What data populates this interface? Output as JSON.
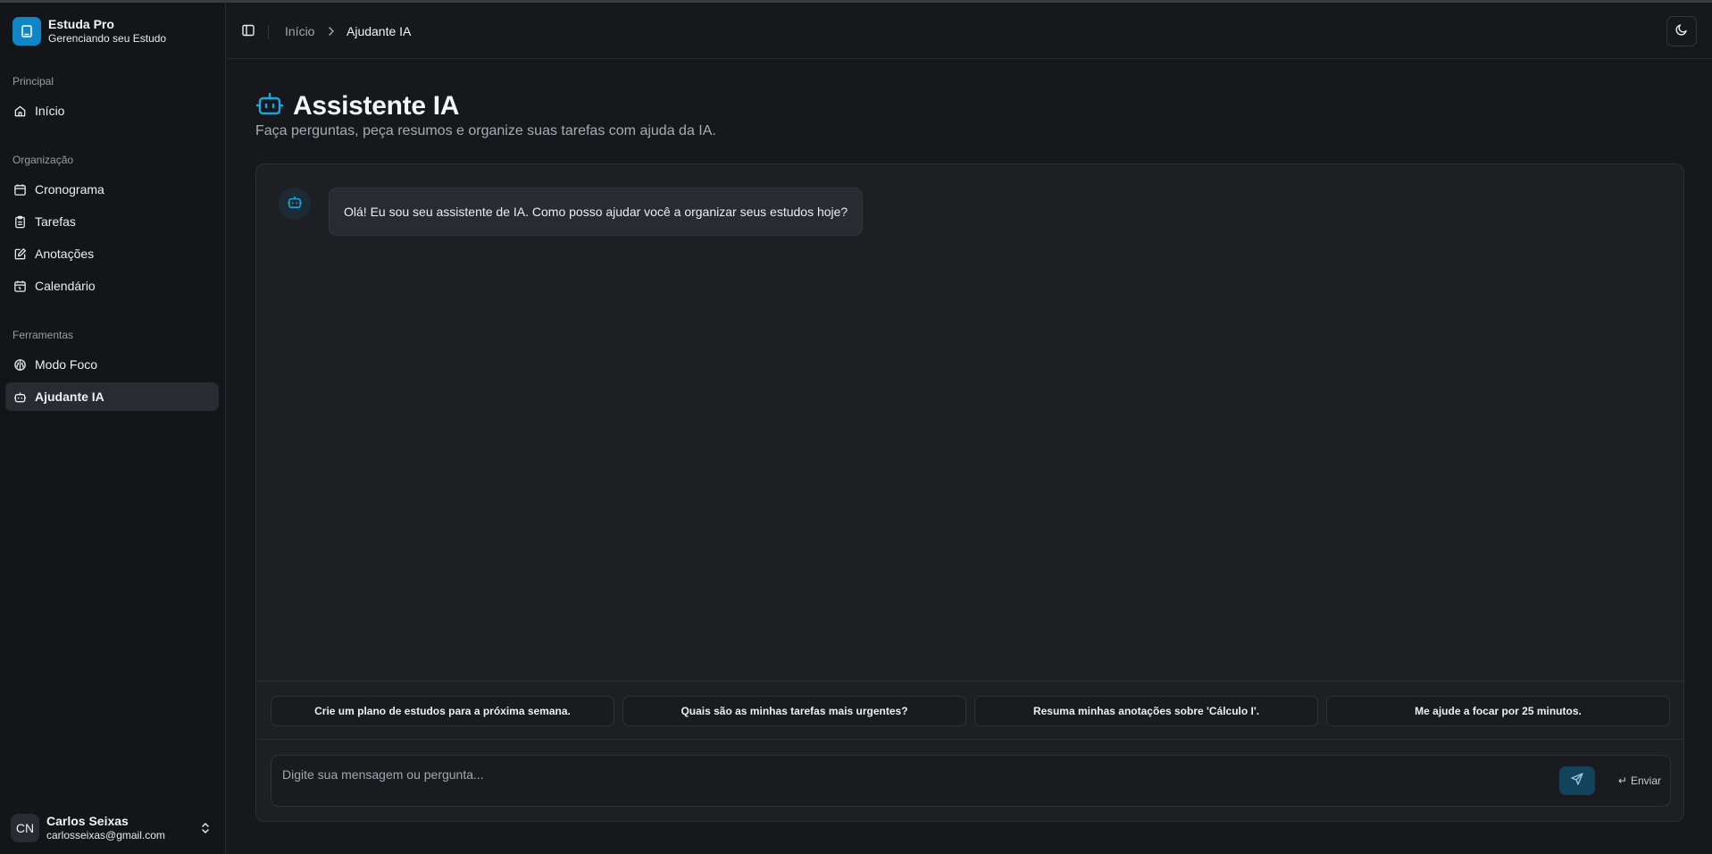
{
  "app": {
    "name": "Estuda Pro",
    "tagline": "Gerenciando seu Estudo"
  },
  "sidebar": {
    "groups": [
      {
        "label": "Principal",
        "items": [
          {
            "label": "Início",
            "icon": "home-icon"
          }
        ]
      },
      {
        "label": "Organização",
        "items": [
          {
            "label": "Cronograma",
            "icon": "calendar-icon"
          },
          {
            "label": "Tarefas",
            "icon": "clipboard-icon"
          },
          {
            "label": "Anotações",
            "icon": "edit-note-icon"
          },
          {
            "label": "Calendário",
            "icon": "calendar-days-icon"
          }
        ]
      },
      {
        "label": "Ferramentas",
        "items": [
          {
            "label": "Modo Foco",
            "icon": "brain-icon"
          },
          {
            "label": "Ajudante IA",
            "icon": "bot-icon",
            "active": true
          }
        ]
      }
    ]
  },
  "user": {
    "initials": "CN",
    "name": "Carlos Seixas",
    "email": "carlosseixas@gmail.com"
  },
  "header": {
    "breadcrumb_home": "Início",
    "breadcrumb_current": "Ajudante IA"
  },
  "page": {
    "title": "Assistente IA",
    "subtitle": "Faça perguntas, peça resumos e organize suas tarefas com ajuda da IA."
  },
  "chat": {
    "messages": [
      {
        "role": "assistant",
        "text": "Olá! Eu sou seu assistente de IA. Como posso ajudar você a organizar seus estudos hoje?"
      }
    ],
    "suggestions": [
      "Crie um plano de estudos para a próxima semana.",
      "Quais são as minhas tarefas mais urgentes?",
      "Resuma minhas anotações sobre 'Cálculo I'.",
      "Me ajude a focar por 25 minutos."
    ],
    "input_placeholder": "Digite sua mensagem ou pergunta...",
    "send_hint_key": "↵",
    "send_hint_label": "Enviar"
  },
  "colors": {
    "accent": "#0f87c7",
    "accent_dark": "#12435a",
    "background": "#17181c",
    "sidebar": "#141518"
  }
}
